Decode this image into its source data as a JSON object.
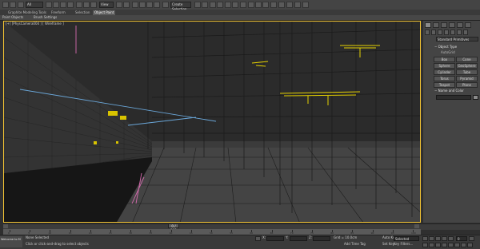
{
  "toolbar": {
    "dropdown_all": "All",
    "dropdown_view": "View",
    "dropdown_selection": "Create Selection Se"
  },
  "ribbon": {
    "tabs": [
      {
        "label": "Graphite Modeling Tools"
      },
      {
        "label": "Freeform"
      },
      {
        "label": "Selection"
      },
      {
        "label": "Object Paint"
      }
    ],
    "panel_labels": [
      "Paint Objects",
      "Brush Settings"
    ]
  },
  "viewport": {
    "label": "[+] [PhysCamera004 ] [ Wireframe ]",
    "accent_color": "#f1c232"
  },
  "command_panel": {
    "category": "Standard Primitives",
    "object_type_title": "Object Type",
    "autogrid": "AutoGrid",
    "buttons": [
      "Box",
      "Cone",
      "Sphere",
      "GeoSphere",
      "Cylinder",
      "Tube",
      "Torus",
      "Pyramid",
      "Teapot",
      "Plane"
    ],
    "name_color_title": "Name and Color"
  },
  "time_slider": {
    "frame_label": "0 / 100",
    "current_frame": 0,
    "total_frames": 100
  },
  "track_ticks": [
    "0",
    "5",
    "10",
    "15",
    "20",
    "25",
    "30",
    "35",
    "40",
    "45",
    "50",
    "55",
    "60",
    "65",
    "70",
    "75",
    "80",
    "85",
    "90",
    "95",
    "100"
  ],
  "status": {
    "selection": "None Selected",
    "prompt": "Click or click-and-drag to select objects",
    "welcome": "Welcome to M",
    "x_label": "X:",
    "y_label": "Y:",
    "z_label": "Z:",
    "grid": "Grid = 10.0cm",
    "add_time_tag": "Add Time Tag",
    "auto_key": "Auto Key",
    "selected": "Selected",
    "set_key": "Set Key",
    "key_filters": "Key Filters...",
    "frame_value": "0"
  }
}
